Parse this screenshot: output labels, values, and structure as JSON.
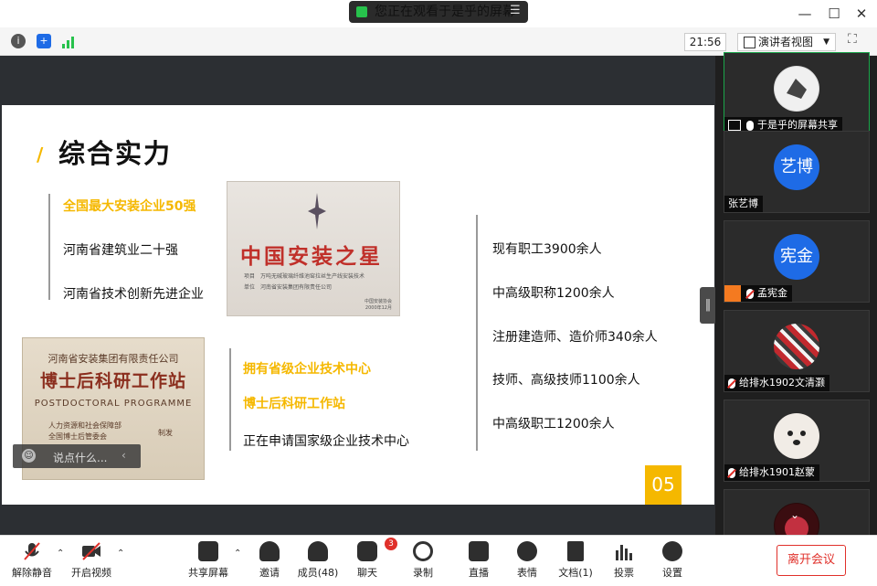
{
  "window": {
    "title": "您正在观看于是乎的屏幕"
  },
  "toolbar": {
    "clock": "21:56",
    "view_mode": "演讲者视图"
  },
  "slide": {
    "title": "综合实力",
    "left_list": [
      "全国最大安装企业50强",
      "河南省建筑业二十强",
      "河南省技术创新先进企业"
    ],
    "middle_list": [
      "拥有省级企业技术中心",
      "博士后科研工作站",
      "正在申请国家级企业技术中心"
    ],
    "right_list": [
      "现有职工3900余人",
      "中高级职称1200余人",
      "注册建造师、造价师340余人",
      "技师、高级技师1100余人",
      "中高级职工1200余人"
    ],
    "page_number": "05",
    "award1": {
      "title": "中国安装之星",
      "line1": "项目　万吨无碱玻璃纤维池窑拉丝生产线安装技术",
      "line2": "单位　河南省安装集团有限责任公司",
      "issuer": "中国安装协会",
      "date": "2000年12月"
    },
    "award2": {
      "company": "河南省安装集团有限责任公司",
      "title": "博士后科研工作站",
      "english": "POSTDOCTORAL PROGRAMME",
      "issuer1": "人力资源和社会保障部",
      "issuer2": "全国博士后管委会",
      "suffix": "制发"
    }
  },
  "chat": {
    "placeholder": "说点什么..."
  },
  "participants": [
    {
      "name": "于是乎的屏幕共享",
      "initials": "",
      "active": true
    },
    {
      "name": "张艺博",
      "initials": "艺博"
    },
    {
      "name": "孟宪金",
      "initials": "宪金"
    },
    {
      "name": "给排水1902文清灏",
      "initials": ""
    },
    {
      "name": "给排水1901赵蒙",
      "initials": ""
    },
    {
      "name": "",
      "initials": ""
    }
  ],
  "bottom": {
    "unmute": "解除静音",
    "video": "开启视频",
    "share": "共享屏幕",
    "invite": "邀请",
    "members": "成员(48)",
    "chat": "聊天",
    "chat_badge": "3",
    "record": "录制",
    "live": "直播",
    "reactions": "表情",
    "docs": "文档(1)",
    "vote": "投票",
    "settings": "设置",
    "leave": "离开会议"
  },
  "colors": {
    "accent": "#f5b800",
    "red": "#e0302a",
    "blue": "#1e6be6",
    "green": "#1aa54a"
  }
}
